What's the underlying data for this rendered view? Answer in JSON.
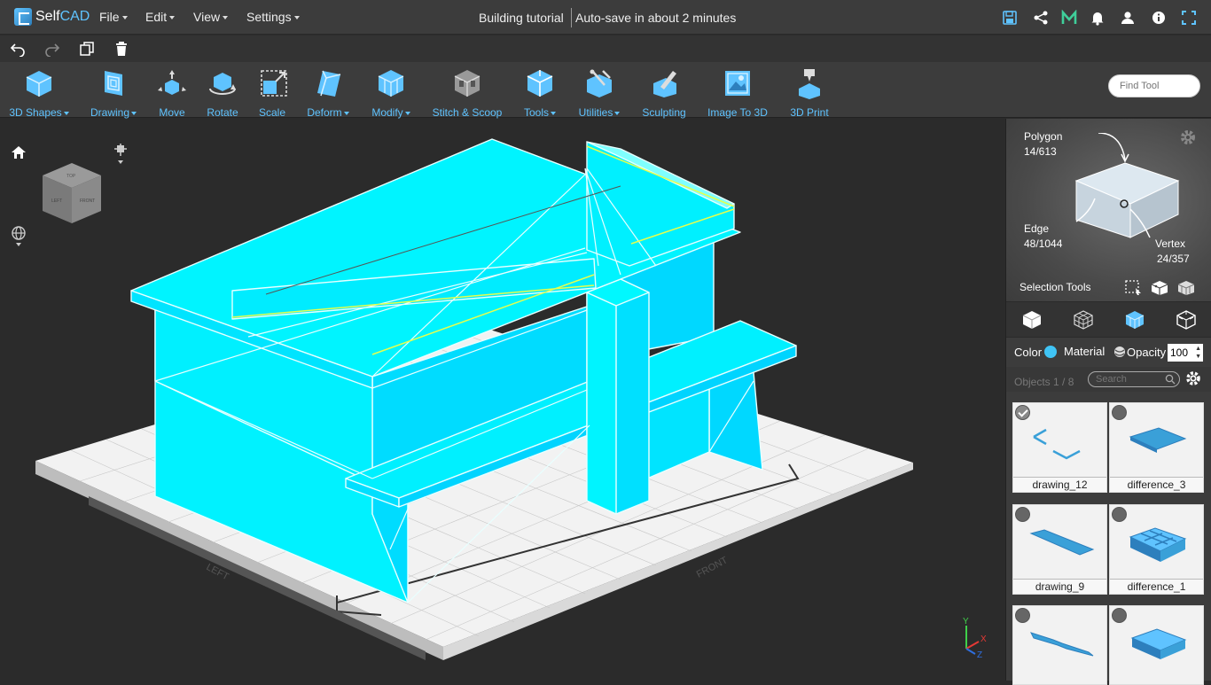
{
  "app": {
    "logo_part1": "Self",
    "logo_part2": "CAD"
  },
  "menu": {
    "file": "File",
    "edit": "Edit",
    "view": "View",
    "settings": "Settings"
  },
  "document": {
    "title": "Building tutorial",
    "autosave": "Auto-save in about 2 minutes"
  },
  "toolbar": {
    "items": [
      {
        "label": "3D Shapes",
        "dropdown": true
      },
      {
        "label": "Drawing",
        "dropdown": true
      },
      {
        "label": "Move",
        "dropdown": false
      },
      {
        "label": "Rotate",
        "dropdown": false
      },
      {
        "label": "Scale",
        "dropdown": false
      },
      {
        "label": "Deform",
        "dropdown": true
      },
      {
        "label": "Modify",
        "dropdown": true
      },
      {
        "label": "Stitch & Scoop",
        "dropdown": false
      },
      {
        "label": "Tools",
        "dropdown": true
      },
      {
        "label": "Utilities",
        "dropdown": true
      },
      {
        "label": "Sculpting",
        "dropdown": false
      },
      {
        "label": "Image To 3D",
        "dropdown": false
      },
      {
        "label": "3D Print",
        "dropdown": false
      }
    ],
    "find_placeholder": "Find Tool"
  },
  "viewport": {
    "label_left": "LEFT",
    "label_front": "FRONT",
    "cube_labels": {
      "top": "TOP",
      "left": "LEFT",
      "front": "FRONT"
    },
    "axes": {
      "x": "X",
      "y": "Y",
      "z": "Z"
    }
  },
  "selection": {
    "polygon_label": "Polygon",
    "polygon_count": "14/613",
    "edge_label": "Edge",
    "edge_count": "48/1044",
    "vertex_label": "Vertex",
    "vertex_count": "24/357",
    "tools_label": "Selection Tools"
  },
  "properties": {
    "color_label": "Color",
    "material_label": "Material",
    "opacity_label": "Opacity",
    "opacity_value": "100",
    "color_value": "#40c4f5"
  },
  "objects": {
    "count_label": "Objects 1 / 8",
    "search_placeholder": "Search",
    "items": [
      {
        "name": "drawing_12",
        "selected": true
      },
      {
        "name": "difference_3",
        "selected": false
      },
      {
        "name": "drawing_9",
        "selected": false
      },
      {
        "name": "difference_1",
        "selected": false
      },
      {
        "name": "",
        "selected": false
      },
      {
        "name": "",
        "selected": false
      }
    ]
  },
  "colors": {
    "accent": "#5fc3ff",
    "model": "#00f0ff",
    "background": "#2b2b2b"
  }
}
